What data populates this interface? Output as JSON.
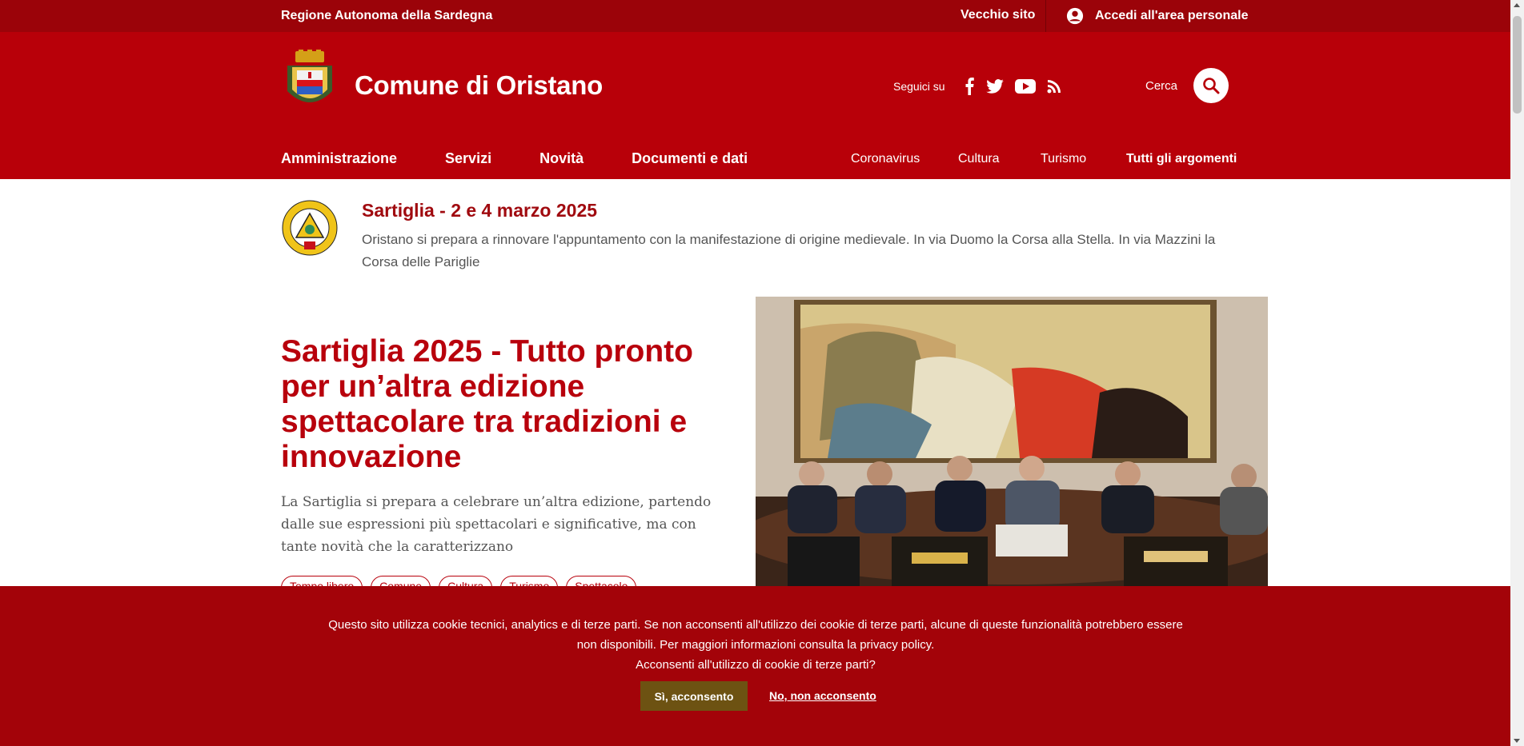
{
  "topbar": {
    "region": "Regione Autonoma della Sardegna",
    "old_site": "Vecchio sito",
    "login": "Accedi all'area personale"
  },
  "header": {
    "title": "Comune di Oristano",
    "follow": "Seguici su",
    "social_icons": [
      "facebook-icon",
      "twitter-icon",
      "youtube-icon",
      "rss-icon"
    ],
    "search_label": "Cerca"
  },
  "nav": {
    "main": [
      "Amministrazione",
      "Servizi",
      "Novità",
      "Documenti e dati"
    ],
    "topics": [
      "Coronavirus",
      "Cultura",
      "Turismo"
    ],
    "all_topics": "Tutti gli argomenti"
  },
  "alert": {
    "title": "Sartiglia - 2 e 4 marzo 2025",
    "text": "Oristano si prepara a rinnovare l'appuntamento con la manifestazione di origine medievale. In via Duomo la Corsa alla Stella. In via Mazzini la Corsa delle Pariglie"
  },
  "hero": {
    "title": "Sartiglia 2025 - Tutto pronto per un’altra edizione spettacolare tra tradizioni e innovazione",
    "text": "La Sartiglia si prepara a celebrare un’altra edizione, partendo dalle sue espressioni più spettacolari e significative, ma con tante novità che la caratterizzano",
    "tags": [
      "Tempo libero",
      "Comune",
      "Cultura",
      "Turismo",
      "Spettacolo"
    ]
  },
  "cookie": {
    "message_line1": "Questo sito utilizza cookie tecnici, analytics e di terze parti. Se non acconsenti all'utilizzo dei cookie di terze parti, alcune di queste funzionalità potrebbero essere",
    "message_line2": "non disponibili. Per maggiori informazioni consulta la privacy policy.",
    "question": "Acconsenti all'utilizzo di cookie di terze parti?",
    "accept": "Sì, acconsento",
    "reject": "No, non acconsento"
  },
  "colors": {
    "brand_red": "#b80009",
    "topbar_red": "#9b0309",
    "cookie_red": "#a30309",
    "accept_button": "#6d5212"
  }
}
